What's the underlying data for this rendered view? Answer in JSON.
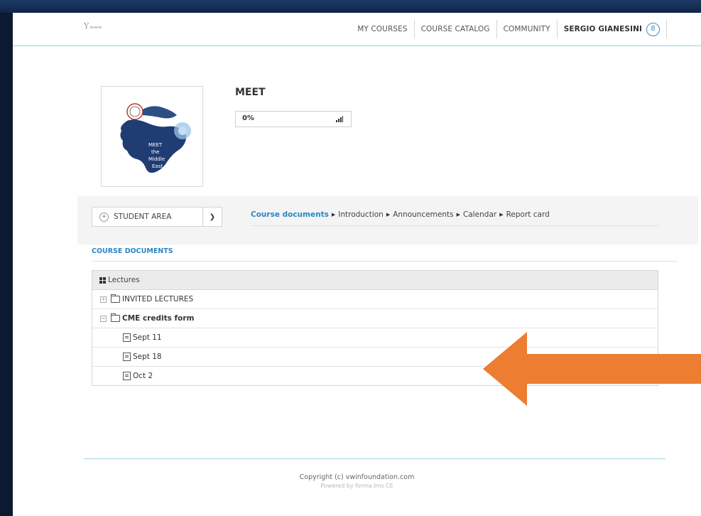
{
  "header": {
    "logo_text": "Y",
    "nav": [
      "MY COURSES",
      "COURSE CATALOG",
      "COMMUNITY"
    ],
    "user_name": "SERGIO GIANESINI",
    "avatar_icon": "user-icon"
  },
  "course": {
    "title": "MEET",
    "progress_label": "0%",
    "progress_value": 0,
    "progress_icon": "signal-bars-icon",
    "thumbnail_text": "MEET the Middle East"
  },
  "student_area": {
    "label": "STUDENT AREA"
  },
  "breadcrumbs": [
    "Course documents",
    "Introduction",
    "Announcements",
    "Calendar",
    "Report card"
  ],
  "section_title": "COURSE DOCUMENTS",
  "documents": {
    "header": "Lectures",
    "rows": [
      {
        "label": "INVITED LECTURES"
      },
      {
        "label": "CME credits form"
      },
      {
        "label": "Sept 11"
      },
      {
        "label": "Sept 18"
      },
      {
        "label": "Oct 2"
      }
    ]
  },
  "footer": {
    "copyright": "Copyright (c) vwinfoundation.com",
    "powered": "Powered by forma.lms CE"
  },
  "colors": {
    "accent_blue": "#2a86c6",
    "divider_teal": "#9fd3e0",
    "arrow_orange": "#ed7d31",
    "bezel_navy": "#0b1a30"
  }
}
